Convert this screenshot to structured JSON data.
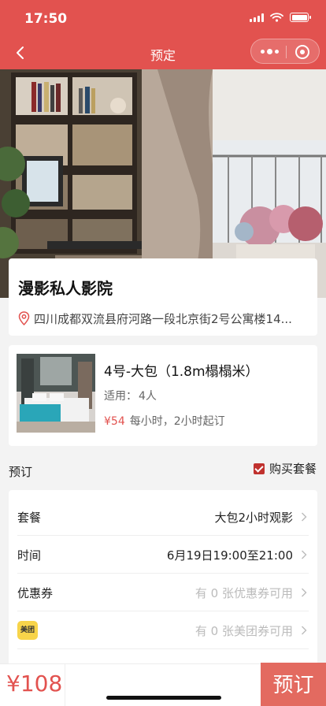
{
  "status": {
    "time": "17:50"
  },
  "nav": {
    "title": "预定"
  },
  "venue": {
    "name": "漫影私人影院",
    "address": "四川成都双流县府河路一段北京街2号公寓楼14..."
  },
  "room": {
    "name": "4号-大包（1.8m榻榻米）",
    "capacity_label": "适用：",
    "capacity": "4人",
    "price": "¥54",
    "price_note": "每小时，2小时起订"
  },
  "booking": {
    "section_label": "预订",
    "buy_package_label": "购买套餐",
    "buy_package_checked": true,
    "rows": [
      {
        "label": "套餐",
        "value": "大包2小时观影"
      },
      {
        "label": "时间",
        "value": "6月19日19:00至21:00"
      },
      {
        "label": "优惠券",
        "value": "有 0 张优惠券可用"
      },
      {
        "label": "美团",
        "value": "有 0 张美团券可用"
      }
    ]
  },
  "footer": {
    "total": "¥108",
    "book_label": "预订"
  },
  "colors": {
    "brand": "#e2524f",
    "button": "#e36a60"
  }
}
